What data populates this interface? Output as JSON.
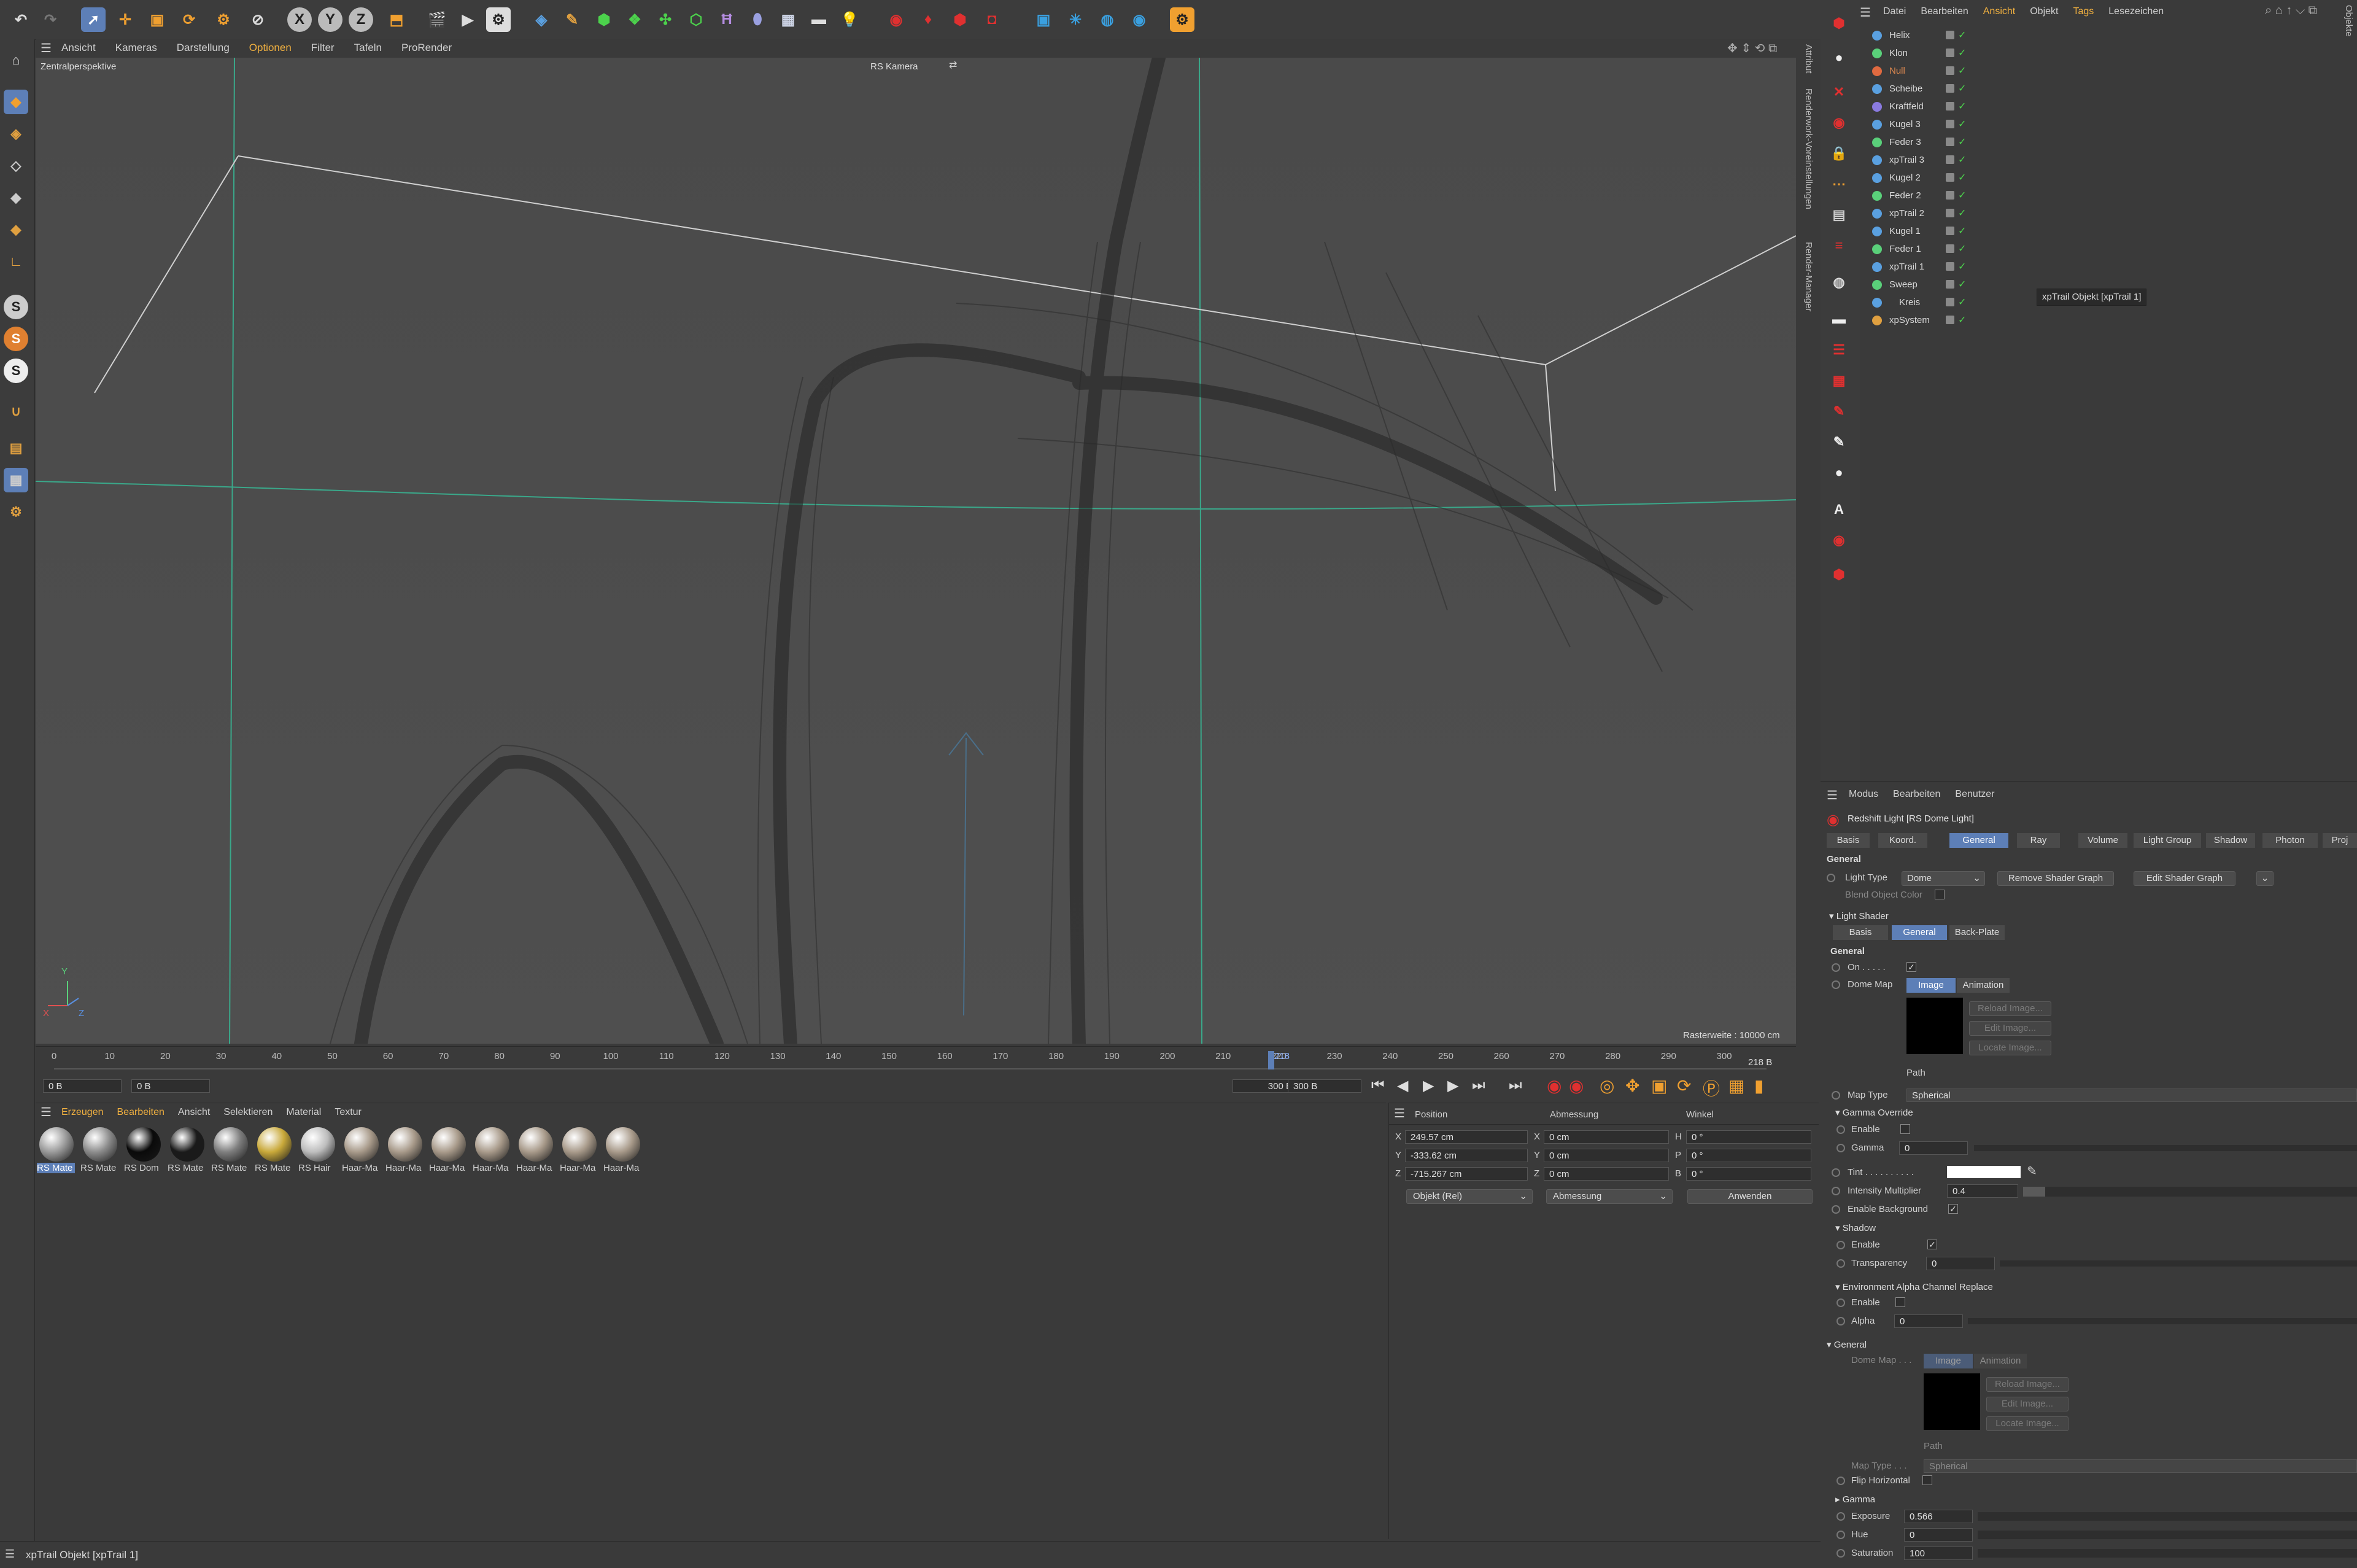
{
  "toolbar": {
    "axis_x": "X",
    "axis_y": "Y",
    "axis_z": "Z"
  },
  "viewport_menu": [
    "Ansicht",
    "Kameras",
    "Darstellung",
    "Optionen",
    "Filter",
    "Tafeln",
    "ProRender"
  ],
  "viewport": {
    "camera_mode": "Zentralperspektive",
    "camera_name": "RS Kamera",
    "grid_info": "Rasterweite : 10000 cm",
    "axis_y": "Y",
    "axis_x": "X",
    "axis_z": "Z"
  },
  "side_tabs": {
    "tab1": "Renderwork-Voreinstellungen",
    "tab2": "Render-Manager",
    "attribute": "Attribut",
    "objekte": "Objekte"
  },
  "timeline": {
    "ticks": [
      "0",
      "10",
      "20",
      "30",
      "40",
      "50",
      "60",
      "70",
      "80",
      "90",
      "100",
      "110",
      "120",
      "130",
      "140",
      "150",
      "160",
      "170",
      "180",
      "190",
      "200",
      "210",
      "220",
      "230",
      "240",
      "250",
      "260",
      "270",
      "280",
      "290",
      "300"
    ],
    "current_frame": "218",
    "current_frame_label": "218 B",
    "start_field": "0 B",
    "start_field2": "0 B",
    "end_field": "300 B",
    "end_field2": "300 B"
  },
  "material_menu": [
    "Erzeugen",
    "Bearbeiten",
    "Ansicht",
    "Selektieren",
    "Material",
    "Textur"
  ],
  "materials": [
    {
      "label": "RS Mate",
      "color": "#9a9a9a",
      "selected": true
    },
    {
      "label": "RS Mate",
      "color": "#8c8c8c"
    },
    {
      "label": "RS Dom",
      "color": "#0a0a0a"
    },
    {
      "label": "RS Mate",
      "color": "#1a1a1a"
    },
    {
      "label": "RS Mate",
      "color": "#7e7e7e"
    },
    {
      "label": "RS Mate",
      "color": "#c9a93a"
    },
    {
      "label": "RS Hair",
      "color": "#bdbdbd"
    },
    {
      "label": "Haar-Ma",
      "color": "#a89a8a"
    },
    {
      "label": "Haar-Ma",
      "color": "#a89a8a"
    },
    {
      "label": "Haar-Ma",
      "color": "#a89a8a"
    },
    {
      "label": "Haar-Ma",
      "color": "#a89a8a"
    },
    {
      "label": "Haar-Ma",
      "color": "#a89a8a"
    },
    {
      "label": "Haar-Ma",
      "color": "#a89a8a"
    },
    {
      "label": "Haar-Ma",
      "color": "#a89a8a"
    }
  ],
  "coords": {
    "headers": [
      "Position",
      "Abmessung",
      "Winkel"
    ],
    "rows": [
      {
        "axis": "X",
        "pos": "249.57 cm",
        "size_axis": "X",
        "size": "0 cm",
        "angle_axis": "H",
        "angle": "0 °"
      },
      {
        "axis": "Y",
        "pos": "-333.62 cm",
        "size_axis": "Y",
        "size": "0 cm",
        "angle_axis": "P",
        "angle": "0 °"
      },
      {
        "axis": "Z",
        "pos": "-715.267 cm",
        "size_axis": "Z",
        "size": "0 cm",
        "angle_axis": "B",
        "angle": "0 °"
      }
    ],
    "mode_select": "Objekt (Rel)",
    "size_select": "Abmessung",
    "apply": "Anwenden"
  },
  "status_bar": "xpTrail Objekt [xpTrail 1]",
  "object_menu": [
    "Datei",
    "Bearbeiten",
    "Ansicht",
    "Objekt",
    "Tags",
    "Lesezeichen"
  ],
  "objects": [
    {
      "name": "Helix",
      "color": "#5aa0e0"
    },
    {
      "name": "Klon",
      "color": "#5ad07a"
    },
    {
      "name": "Null",
      "color": "#e06a40",
      "name_color": "#e08a50"
    },
    {
      "name": "Scheibe",
      "color": "#5aa0e0"
    },
    {
      "name": "Kraftfeld",
      "color": "#8a7ae0"
    },
    {
      "name": "Kugel 3",
      "color": "#5aa0e0"
    },
    {
      "name": "Feder 3",
      "color": "#5ad07a"
    },
    {
      "name": "xpTrail 3",
      "color": "#5aa0e0"
    },
    {
      "name": "Kugel 2",
      "color": "#5aa0e0"
    },
    {
      "name": "Feder 2",
      "color": "#5ad07a"
    },
    {
      "name": "xpTrail 2",
      "color": "#5aa0e0"
    },
    {
      "name": "Kugel 1",
      "color": "#5aa0e0"
    },
    {
      "name": "Feder 1",
      "color": "#5ad07a"
    },
    {
      "name": "xpTrail 1",
      "color": "#5aa0e0"
    },
    {
      "name": "Sweep",
      "color": "#5ad07a"
    },
    {
      "name": "Kreis",
      "color": "#5aa0e0"
    },
    {
      "name": "xpSystem",
      "color": "#e0a040"
    }
  ],
  "tooltip": "xpTrail Objekt [xpTrail 1]",
  "attr_menu": [
    "Modus",
    "Bearbeiten",
    "Benutzer"
  ],
  "attr": {
    "title": "Redshift Light [RS Dome Light]",
    "tabs": [
      "Basis",
      "Koord.",
      "General",
      "Ray",
      "Volume",
      "Light Group",
      "Shadow",
      "Photon",
      "Proj"
    ],
    "section_general": "General",
    "light_type_label": "Light Type",
    "light_type_value": "Dome",
    "remove_shader_graph": "Remove Shader Graph",
    "edit_shader_graph": "Edit Shader Graph",
    "blend_object_color": "Blend Object Color",
    "light_shader": "Light Shader",
    "sub_tabs": [
      "Basis",
      "General",
      "Back-Plate"
    ],
    "general2": "General",
    "on_label": "On . . . . .",
    "dome_map_label": "Dome Map",
    "dome_tabs": [
      "Image",
      "Animation"
    ],
    "reload_image": "Reload Image...",
    "edit_image": "Edit Image...",
    "locate_image": "Locate Image...",
    "path_label": "Path",
    "map_type_label": "Map Type",
    "map_type_value": "Spherical",
    "gamma_override": "Gamma Override",
    "enable": "Enable",
    "gamma_label": "Gamma",
    "gamma_value": "0",
    "tint_label": "Tint . . . . . . . . . .",
    "intensity_label": "Intensity Multiplier",
    "intensity_value": "0.4",
    "enable_background": "Enable Background",
    "shadow": "Shadow",
    "shadow_enable": "Enable",
    "transparency_label": "Transparency",
    "transparency_value": "0",
    "env_alpha": "Environment Alpha Channel Replace",
    "env_enable": "Enable",
    "alpha_label": "Alpha",
    "alpha_value": "0",
    "general3": "General",
    "dome_map2": "Dome Map . . .",
    "dome_tabs2": [
      "Image",
      "Animation"
    ],
    "reload_image2": "Reload Image...",
    "edit_image2": "Edit Image...",
    "locate_image2": "Locate Image...",
    "path2": "Path",
    "map_type2": "Map Type . . .",
    "map_type2_value": "Spherical",
    "flip_horizontal": "Flip Horizontal",
    "gamma_section": "Gamma",
    "exposure_label": "Exposure",
    "exposure_value": "0.566",
    "hue_label": "Hue",
    "hue_value": "0",
    "saturation_label": "Saturation",
    "saturation_value": "100"
  },
  "colors": {
    "accent_blue": "#5d7fb7",
    "active_orange": "#f0b040",
    "check_green": "#4cd24c",
    "guide_green": "#3aa88a"
  }
}
